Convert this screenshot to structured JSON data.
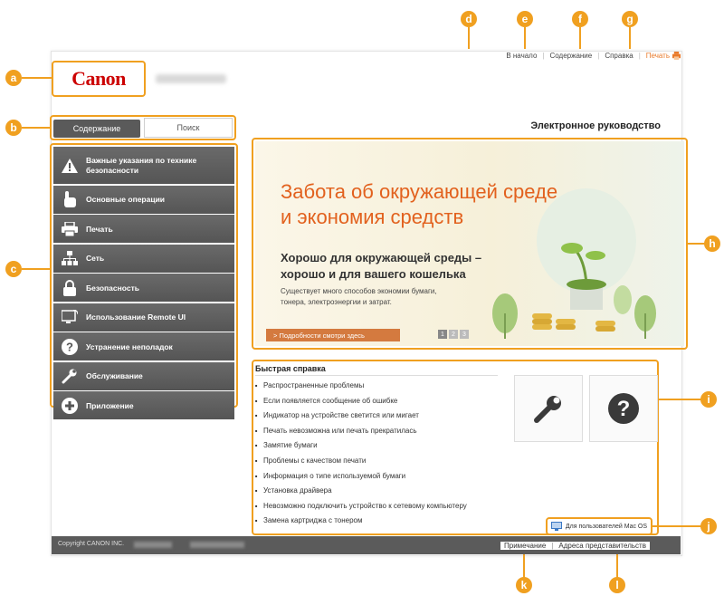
{
  "header": {
    "brand": "Canon",
    "top_links": [
      "В начало",
      "Содержание",
      "Справка",
      "Печать"
    ],
    "manual_title": "Электронное руководство"
  },
  "tabs": [
    "Содержание",
    "Поиск"
  ],
  "sidebar": {
    "items": [
      {
        "label": "Важные указания по технике безопасности",
        "icon": "warning-icon"
      },
      {
        "label": "Основные операции",
        "icon": "hand-pointer-icon"
      },
      {
        "label": "Печать",
        "icon": "printer-icon"
      },
      {
        "label": "Сеть",
        "icon": "network-icon"
      },
      {
        "label": "Безопасность",
        "icon": "lock-icon"
      },
      {
        "label": "Использование Remote UI",
        "icon": "monitor-icon"
      },
      {
        "label": "Устранение неполадок",
        "icon": "question-icon"
      },
      {
        "label": "Обслуживание",
        "icon": "wrench-icon"
      },
      {
        "label": "Приложение",
        "icon": "plus-icon"
      }
    ]
  },
  "banner": {
    "headline_line1": "Забота об окружающей среде",
    "headline_line2": "и экономия средств",
    "sub_line1": "Хорошо для окружающей среды –",
    "sub_line2": "хорошо и для вашего кошелька",
    "desc": "Существует много способов экономии бумаги, тонера, электроэнергии и затрат.",
    "more_button": "> Подробности смотри здесь",
    "pages": [
      "1",
      "2",
      "3"
    ]
  },
  "quick": {
    "title": "Быстрая справка",
    "items": [
      "Распространенные проблемы",
      "Если появляется сообщение об ошибке",
      "Индикатор на устройстве светится или мигает",
      "Печать невозможна или печать прекратилась",
      "Замятие бумаги",
      "Проблемы с качеством печати",
      "Информация о типе используемой бумаги",
      "Установка драйвера",
      "Невозможно подключить устройство к сетевому компьютеру",
      "Замена картриджа с тонером"
    ]
  },
  "mac_button": "Для пользователей Mac OS",
  "footer": {
    "copyright": "Copyright CANON INC.",
    "links": [
      "Примечание",
      "Адреса представительств"
    ]
  },
  "callouts": [
    "a",
    "b",
    "c",
    "d",
    "e",
    "f",
    "g",
    "h",
    "i",
    "j",
    "k",
    "l"
  ],
  "colors": {
    "accent": "#f0a020",
    "brand_red": "#cc0000",
    "banner_orange": "#e2611e"
  }
}
